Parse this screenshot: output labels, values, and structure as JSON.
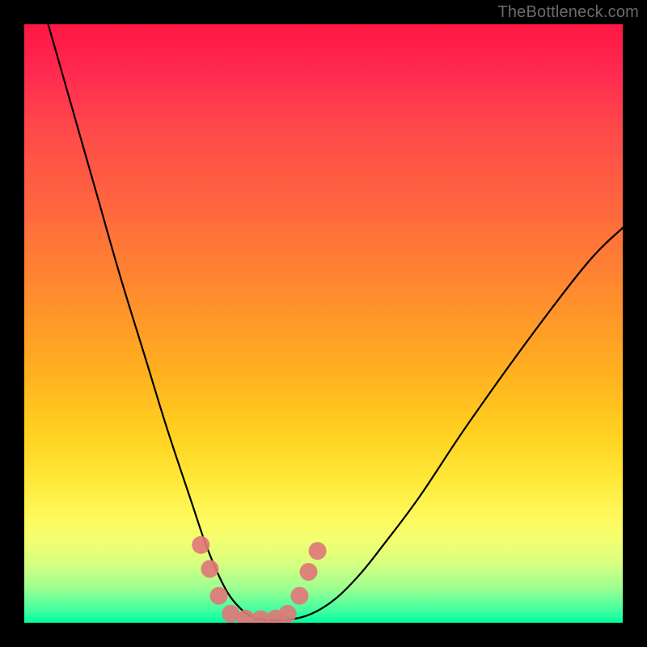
{
  "watermark": "TheBottleneck.com",
  "colors": {
    "gradient_top": "#ff1744",
    "gradient_mid1": "#ff8c2e",
    "gradient_mid2": "#ffe838",
    "gradient_bottom": "#00ff9e",
    "curve_stroke": "#000000",
    "marker_fill": "#e07878",
    "frame": "#000000"
  },
  "chart_data": {
    "type": "line",
    "title": "",
    "xlabel": "",
    "ylabel": "",
    "xlim": [
      0,
      100
    ],
    "ylim": [
      0,
      100
    ],
    "note": "No numeric axes or tick labels are visible in the image; x/y are normalized 0–100 estimates of the plotted curve shape.",
    "series": [
      {
        "name": "curve",
        "x": [
          4,
          8,
          12,
          16,
          20,
          24,
          28,
          30,
          32,
          34,
          36,
          38,
          40,
          44,
          48,
          52,
          56,
          60,
          66,
          74,
          84,
          94,
          100
        ],
        "y": [
          100,
          86,
          72,
          58,
          45,
          32,
          20,
          14,
          9,
          5,
          2.5,
          1,
          0.5,
          0.5,
          1.5,
          4,
          8,
          13,
          21,
          33,
          47,
          60,
          66
        ]
      }
    ],
    "markers": [
      {
        "x": 29.5,
        "y": 13
      },
      {
        "x": 31.0,
        "y": 9
      },
      {
        "x": 32.5,
        "y": 4.5
      },
      {
        "x": 34.5,
        "y": 1.5
      },
      {
        "x": 37.0,
        "y": 0.7
      },
      {
        "x": 39.5,
        "y": 0.6
      },
      {
        "x": 42.0,
        "y": 0.7
      },
      {
        "x": 44.0,
        "y": 1.5
      },
      {
        "x": 46.0,
        "y": 4.5
      },
      {
        "x": 47.5,
        "y": 8.5
      },
      {
        "x": 49.0,
        "y": 12
      }
    ]
  }
}
